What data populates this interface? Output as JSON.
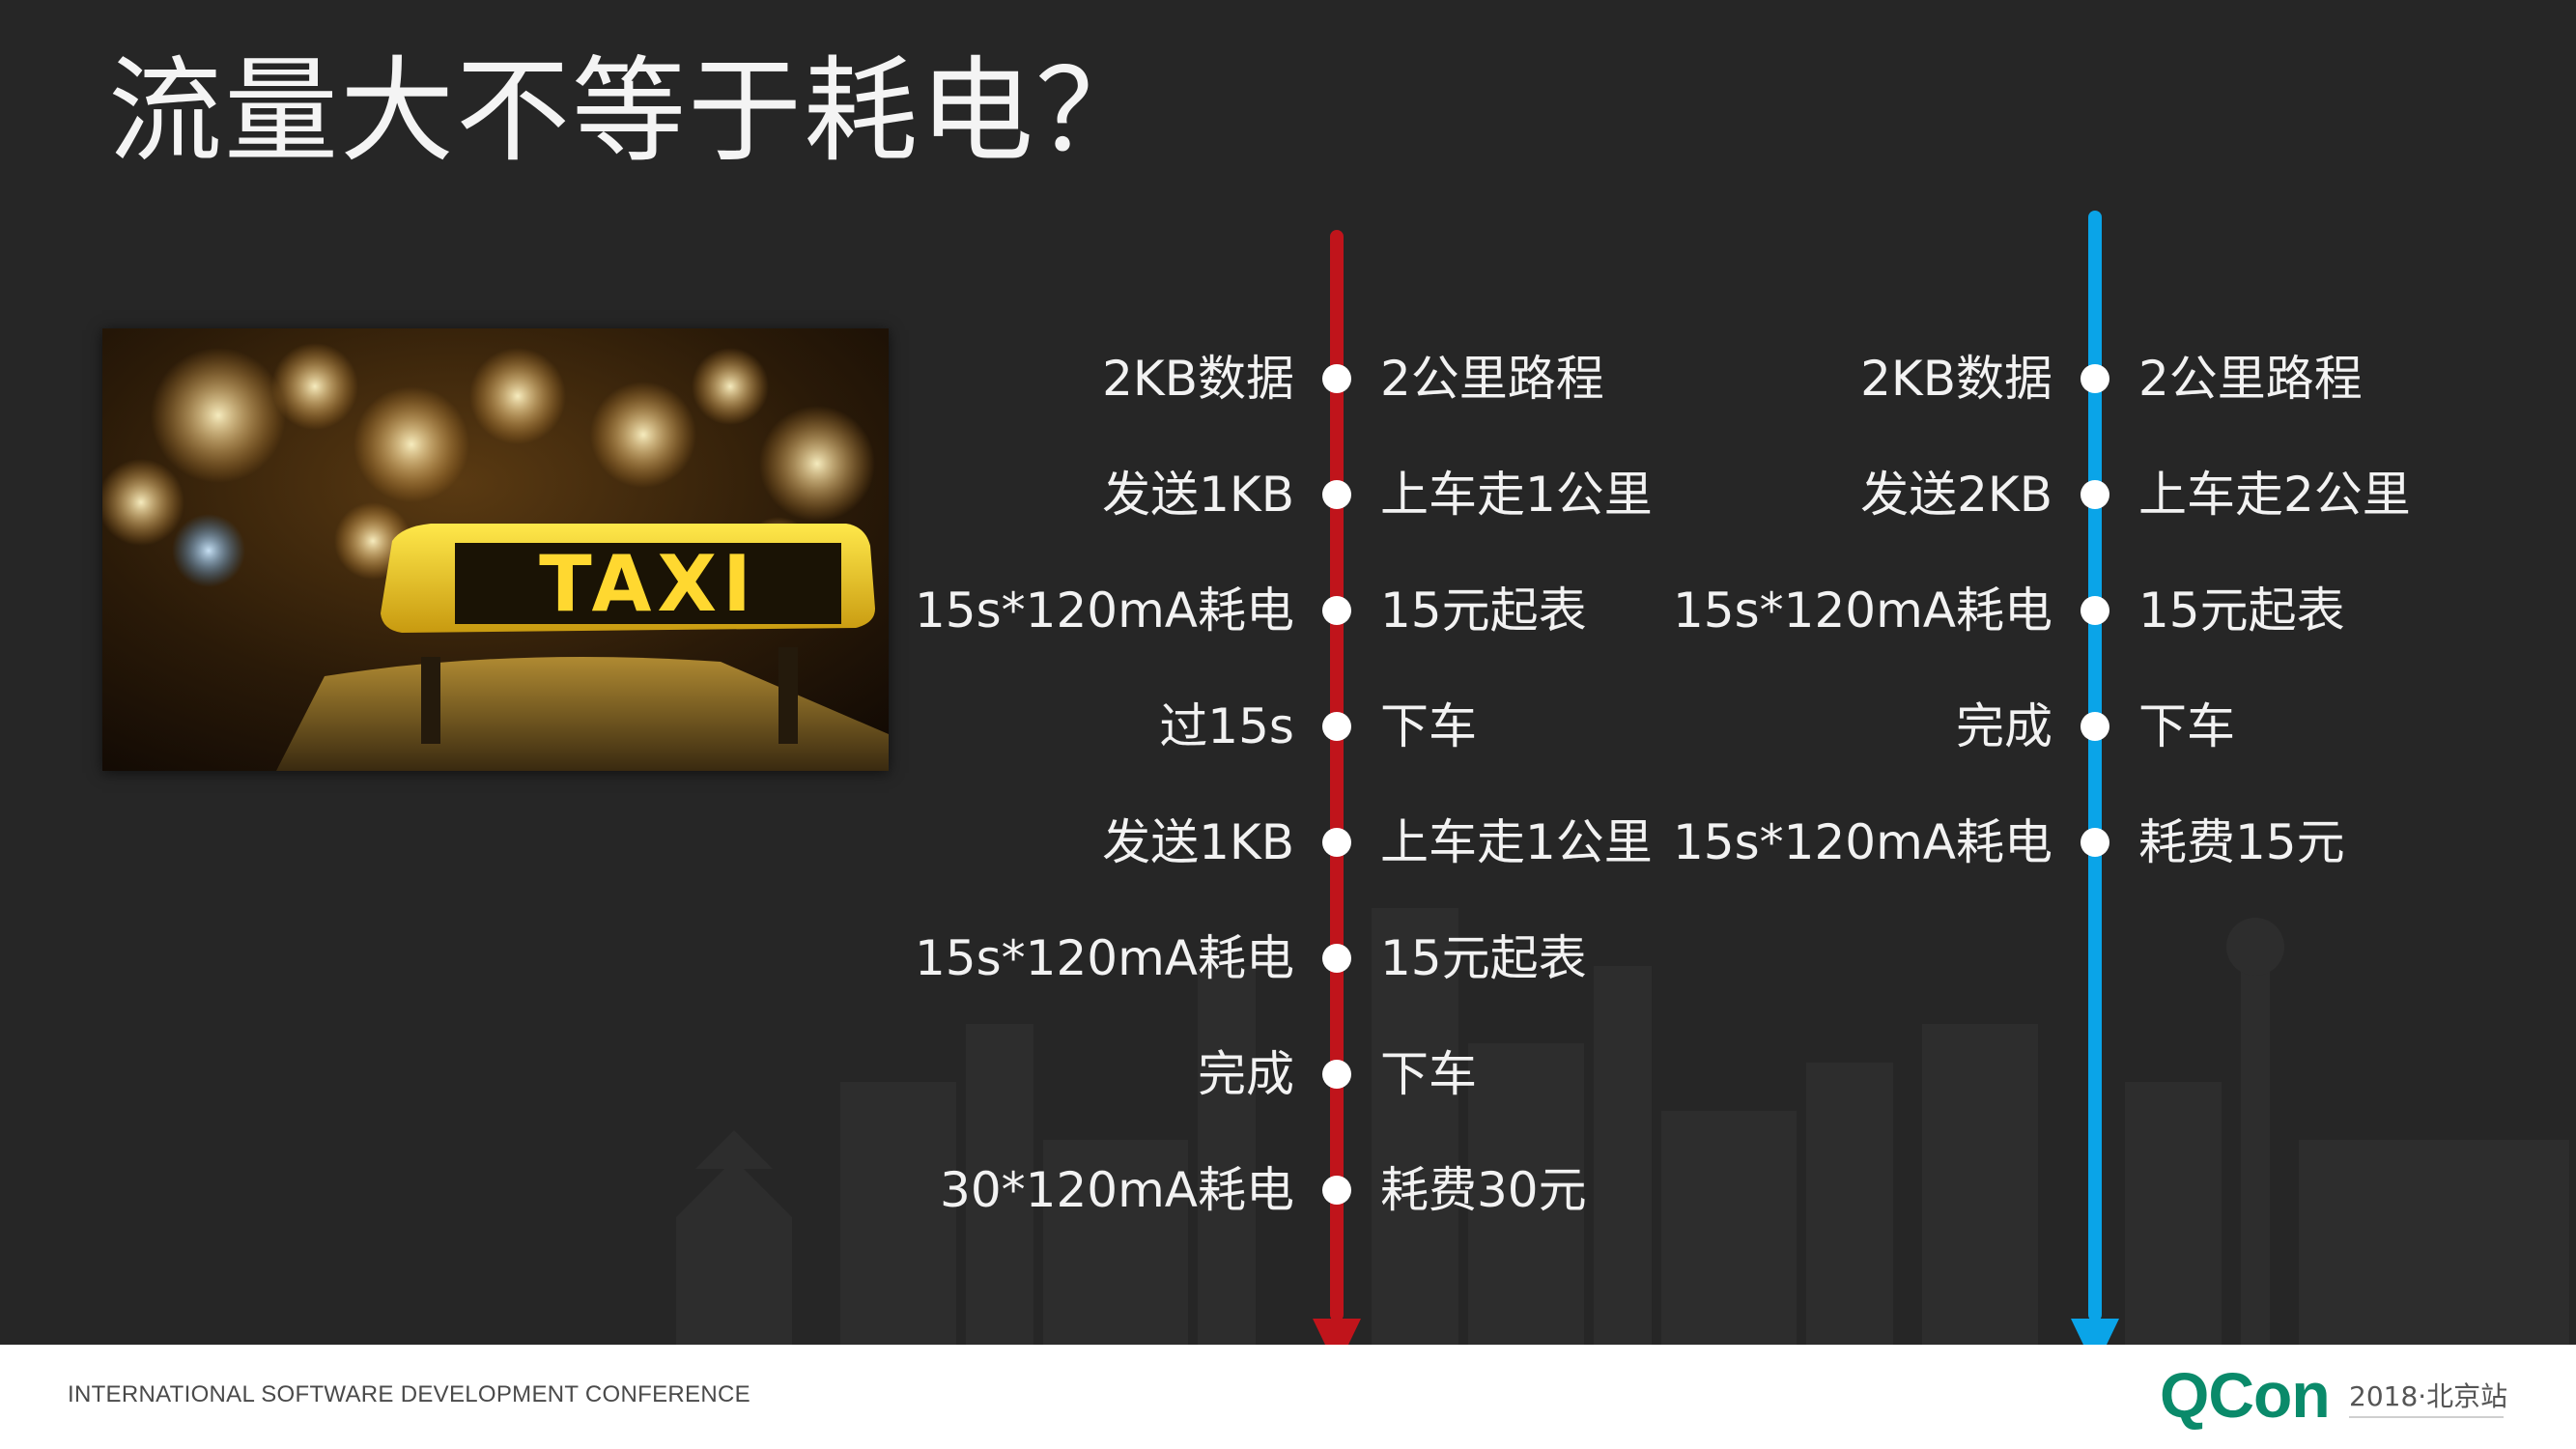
{
  "slide": {
    "title": "流量大不等于耗电？"
  },
  "left_timeline": {
    "rows": [
      {
        "left": "2KB数据",
        "right": "2公里路程"
      },
      {
        "left": "发送1KB",
        "right": "上车走1公里"
      },
      {
        "left": "15s*120mA耗电",
        "right": "15元起表"
      },
      {
        "left": "过15s",
        "right": "下车"
      },
      {
        "left": "发送1KB",
        "right": "上车走1公里"
      },
      {
        "left": "15s*120mA耗电",
        "right": "15元起表"
      },
      {
        "left": "完成",
        "right": "下车"
      },
      {
        "left": "30*120mA耗电",
        "right": "耗费30元"
      }
    ],
    "color": "#c0141b"
  },
  "right_timeline": {
    "rows": [
      {
        "left": "2KB数据",
        "right": "2公里路程"
      },
      {
        "left": "发送2KB",
        "right": "上车走2公里"
      },
      {
        "left": "15s*120mA耗电",
        "right": "15元起表"
      },
      {
        "left": "完成",
        "right": "下车"
      },
      {
        "left": "15s*120mA耗电",
        "right": "耗费15元"
      }
    ],
    "color": "#0aa4e8"
  },
  "photo": {
    "sign_text": "TAXI"
  },
  "footer": {
    "conference": "INTERNATIONAL SOFTWARE DEVELOPMENT CONFERENCE",
    "brand": "QCon",
    "edition": "2018·北京站"
  }
}
